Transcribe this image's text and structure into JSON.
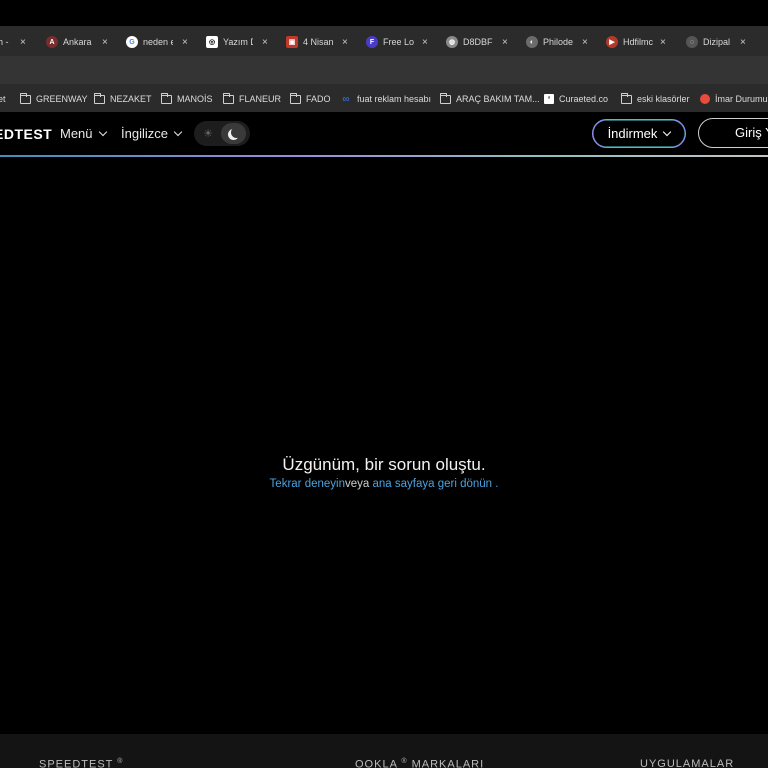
{
  "browser": {
    "tabs": [
      {
        "title": "h -",
        "favicon_color": "#2b2b2b",
        "favicon": ""
      },
      {
        "title": "Ankara",
        "favicon_color": "#7a2d2d",
        "favicon": "A"
      },
      {
        "title": "neden e",
        "favicon_color": "#ffffff",
        "favicon": "G"
      },
      {
        "title": "Yazım D",
        "favicon_color": "#ffffff",
        "favicon": "◎"
      },
      {
        "title": "4 Nisan",
        "favicon_color": "#c0392b",
        "favicon": "▣"
      },
      {
        "title": "Free Lo",
        "favicon_color": "#4a3cc7",
        "favicon": "F"
      },
      {
        "title": "D8DBF",
        "favicon_color": "#8a8a8a",
        "favicon": "◍"
      },
      {
        "title": "Philode",
        "favicon_color": "#6b6b6b",
        "favicon": "◐"
      },
      {
        "title": "Hdfilmc",
        "favicon_color": "#b33a2b",
        "favicon": "▶"
      },
      {
        "title": "Dizipal",
        "favicon_color": "#555555",
        "favicon": "◌"
      }
    ],
    "close_glyph": "×",
    "bookmarks": [
      {
        "label": "et",
        "type": "text"
      },
      {
        "label": "GREENWAY",
        "type": "folder"
      },
      {
        "label": "NEZAKET",
        "type": "folder"
      },
      {
        "label": "MANOİS",
        "type": "folder"
      },
      {
        "label": "FLANEUR",
        "type": "folder"
      },
      {
        "label": "FADO",
        "type": "folder"
      },
      {
        "label": "fuat reklam hesabı",
        "type": "meta"
      },
      {
        "label": "ARAÇ BAKIM TAM...",
        "type": "folder"
      },
      {
        "label": "Curaeted.co",
        "type": "site"
      },
      {
        "label": "eski klasörler",
        "type": "folder"
      },
      {
        "label": "İmar Durumu",
        "type": "site2"
      }
    ]
  },
  "header": {
    "logo": "EDTEST",
    "menu_label": "Menü",
    "language_label": "İngilizce",
    "download_label": "İndirmek",
    "login_label": "Giriş Y"
  },
  "error": {
    "title": "Üzgünüm, bir sorun oluştu.",
    "retry_link": "Tekrar deneyin",
    "or_text": "veya",
    "home_link": "ana sayfaya geri dönün",
    "period": "."
  },
  "footer": {
    "col1": "SPEEDTEST",
    "col2": "OOKLA",
    "col2_rest": "MARKALARI",
    "col3": "UYGULAMALAR",
    "reg": "®"
  },
  "colors": {
    "link": "#4aa3e0",
    "accent_purple": "#9c8cff",
    "accent_teal": "#4fd0d8"
  }
}
